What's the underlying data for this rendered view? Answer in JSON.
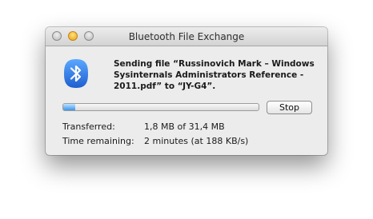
{
  "window": {
    "title": "Bluetooth File Exchange"
  },
  "transfer": {
    "message": "Sending file “Russinovich Mark – Windows Sysinternals Administrators Reference - 2011.pdf” to “JY-G4”.",
    "progress": 0.06,
    "stop_label": "Stop",
    "transferred_label": "Transferred:",
    "transferred_value": "1,8 MB of 31,4 MB",
    "time_remaining_label": "Time remaining:",
    "time_remaining_value": "2 minutes (at 188 KB/s)"
  },
  "icons": {
    "app_icon": "bluetooth-icon",
    "close": "close-button",
    "minimize": "minimize-button",
    "zoom": "zoom-button"
  },
  "colors": {
    "bluetooth_blue": "#2a6fdf",
    "progress_fill": "#3b95e8"
  }
}
